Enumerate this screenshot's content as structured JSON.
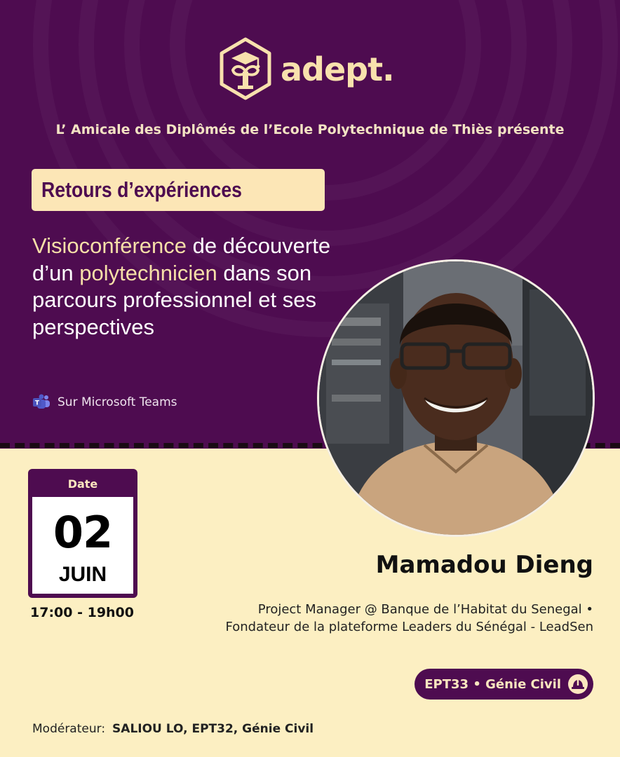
{
  "brand": {
    "name": "adept.",
    "logo_icon": "graduation-emblem-icon"
  },
  "presenter_line": "L’ Amicale des Diplômés de l’Ecole Polytechnique de Thiès présente",
  "tag": "Retours d’expériences",
  "headline": {
    "part1": "Visioconférence",
    "part2": " de découverte d’un ",
    "part3": "polytechnicien",
    "part4": " dans son parcours professionnel et ses perspectives"
  },
  "platform": {
    "label": "Sur Microsoft Teams",
    "icon": "microsoft-teams-icon"
  },
  "event": {
    "date_label": "Date",
    "day": "02",
    "month": "JUIN",
    "time": "17:00 - 19h00"
  },
  "speaker": {
    "name": "Mamadou Dieng",
    "bio": "Project Manager  @ Banque de l’Habitat du Senegal • Fondateur de la plateforme Leaders du Sénégal - LeadSen",
    "promo": "EPT33 • Génie Civil",
    "promo_icon": "hard-hat-icon"
  },
  "moderator": {
    "label": "Modérateur:",
    "value": "SALIOU LO, EPT32, Génie Civil"
  },
  "colors": {
    "primary": "#4e0c50",
    "cream": "#fcefc2",
    "accent": "#f6dfa8"
  }
}
